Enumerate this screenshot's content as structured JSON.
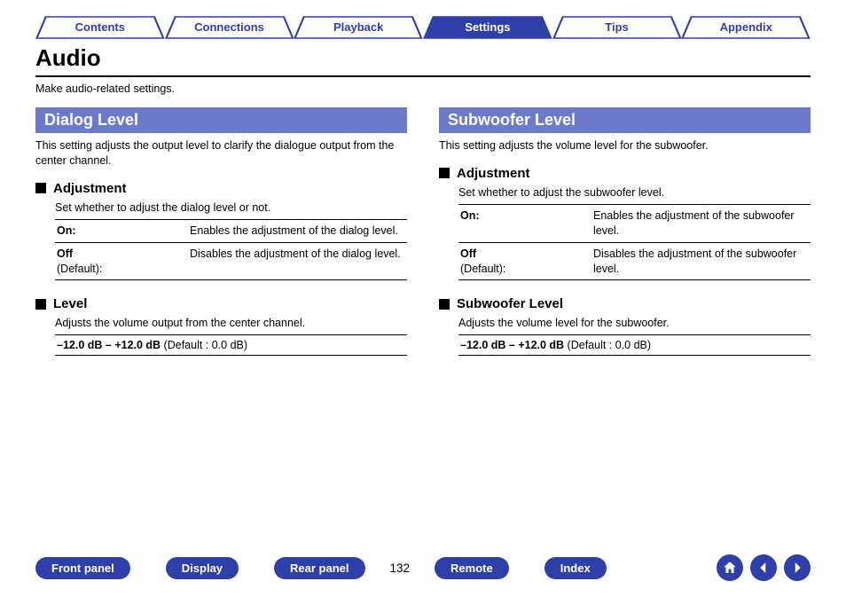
{
  "tabs": {
    "contents": "Contents",
    "connections": "Connections",
    "playback": "Playback",
    "settings": "Settings",
    "tips": "Tips",
    "appendix": "Appendix"
  },
  "title": "Audio",
  "intro": "Make audio-related settings.",
  "left": {
    "bar": "Dialog Level",
    "desc": "This setting adjusts the output level to clarify the dialogue output from the center channel.",
    "adj": {
      "head": "Adjustment",
      "desc": "Set whether to adjust the dialog level or not.",
      "on_key": "On:",
      "on_val": "Enables the adjustment of the dialog level.",
      "off_key1": "Off",
      "off_key2": "(Default):",
      "off_val": "Disables the adjustment of the dialog level."
    },
    "lvl": {
      "head": "Level",
      "desc": "Adjusts the volume output from the center channel.",
      "range_b": "–12.0 dB – +12.0 dB",
      "range_rest": " (Default : 0.0 dB)"
    }
  },
  "right": {
    "bar": "Subwoofer Level",
    "desc": "This setting adjusts the volume level for the subwoofer.",
    "adj": {
      "head": "Adjustment",
      "desc": "Set whether to adjust the subwoofer level.",
      "on_key": "On:",
      "on_val": "Enables the adjustment of the subwoofer level.",
      "off_key1": "Off",
      "off_key2": "(Default):",
      "off_val": "Disables the adjustment of the subwoofer level."
    },
    "lvl": {
      "head": "Subwoofer Level",
      "desc": "Adjusts the volume level for the subwoofer.",
      "range_b": "–12.0 dB – +12.0 dB",
      "range_rest": " (Default : 0.0 dB)"
    }
  },
  "footer": {
    "front": "Front panel",
    "display": "Display",
    "rear": "Rear panel",
    "page": "132",
    "remote": "Remote",
    "index": "Index"
  }
}
